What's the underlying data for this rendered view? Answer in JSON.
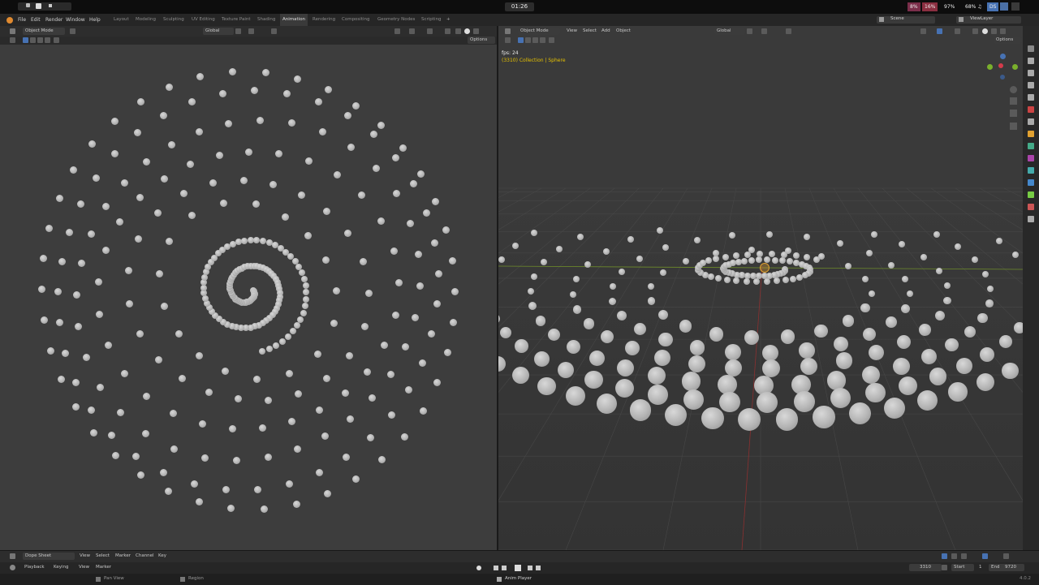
{
  "system_bar": {
    "clock": "01:26",
    "stats": [
      {
        "label": "8%",
        "color": "#7a2e4a"
      },
      {
        "label": "16%",
        "color": "#8a2e40"
      },
      {
        "label": "97%",
        "color": "#3a3a3a"
      },
      {
        "label": "68% ♫",
        "color": "#3a3a3a"
      }
    ],
    "ds_label": "DS"
  },
  "menubar": {
    "menus": [
      "File",
      "Edit",
      "Render",
      "Window",
      "Help"
    ],
    "workspaces": [
      "Layout",
      "Modeling",
      "Sculpting",
      "UV Editing",
      "Texture Paint",
      "Shading",
      "Animation",
      "Rendering",
      "Compositing",
      "Geometry Nodes",
      "Scripting",
      "+"
    ],
    "active_workspace": "Animation",
    "scene": "Scene",
    "view_layer": "ViewLayer"
  },
  "left_viewport": {
    "mode": "Object Mode",
    "orientation": "Global",
    "options": "Options"
  },
  "right_viewport": {
    "mode": "Object Mode",
    "menus": [
      "View",
      "Select",
      "Add",
      "Object"
    ],
    "orientation": "Global",
    "options": "Options",
    "fps": "fps: 24",
    "info": "(3310) Collection | Sphere"
  },
  "dope_sheet": {
    "editor": "Dope Sheet",
    "menus": [
      "View",
      "Select",
      "Marker",
      "Channel",
      "Key"
    ],
    "playback": "Playback",
    "keying": "Keying",
    "view": "View",
    "marker": "Marker",
    "current_frame": "3310",
    "start_label": "Start",
    "start_value": "1",
    "end_label": "End",
    "end_value": "9720",
    "status_left": "Pan View",
    "status_mid": "Region",
    "status_player": "Anim Player",
    "version": "4.0.2"
  },
  "colors": {
    "accent": "#4772b3",
    "active_object": "#e0a030",
    "info_text": "#e5c100",
    "x_axis": "#8a3030",
    "y_axis": "#6e8c2a"
  }
}
